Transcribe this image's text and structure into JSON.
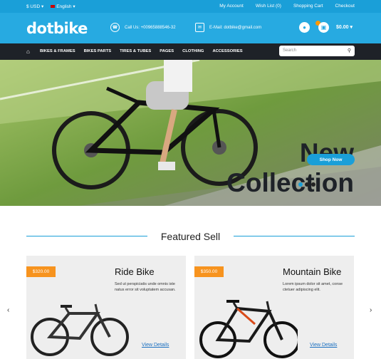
{
  "topbar": {
    "currency": "$ USD ▾",
    "language": "English ▾",
    "links": [
      "My Account",
      "Wish List (0)",
      "Shopping Cart",
      "Checkout"
    ]
  },
  "header": {
    "logo": "dotbike",
    "phone": "Call Us: +00965888546-32",
    "email": "E-Mail: dotbike@gmail.com",
    "cart_total": "$0.00 ▾"
  },
  "nav": {
    "items": [
      "BIKES & FRAMES",
      "BIKES PARTS",
      "TIRES & TUBES",
      "PAGES",
      "CLOTHING",
      "ACCESSORIES"
    ],
    "search_placeholder": "Search"
  },
  "hero": {
    "title_line1": "New",
    "title_line2": "Collection",
    "button": "Shop Now"
  },
  "featured": {
    "title": "Featured Sell",
    "products": [
      {
        "price": "$320.00",
        "name": "Ride Bike",
        "desc": "Sed ut perspiciatis unde omnis iste natus error sit voluptatem accusan.",
        "link": "View Details"
      },
      {
        "price": "$350.00",
        "name": "Mountain Bike",
        "desc": "Lorem ipsum dolor sit amet, conse ctetuer adipiscing elit.",
        "link": "View Details"
      }
    ]
  },
  "colors": {
    "brand_blue": "#27aae1",
    "topbar_blue": "#1a9fd8",
    "nav_dark": "#1e2228",
    "price_orange": "#f7931e"
  }
}
